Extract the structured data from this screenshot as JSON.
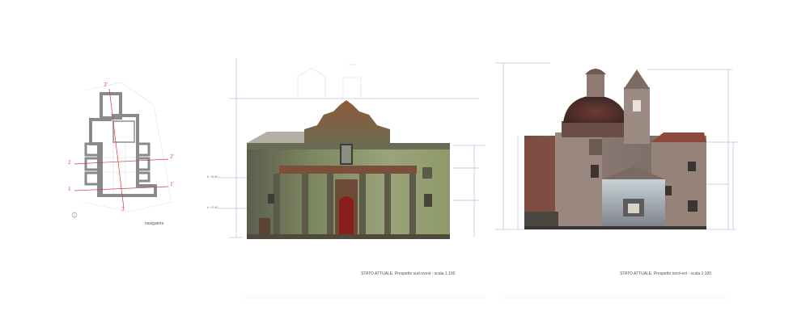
{
  "plan": {
    "caption": "navigatore",
    "section_marks": [
      "1'",
      "2'",
      "3'",
      "1",
      "2",
      "3"
    ]
  },
  "elevation_south": {
    "caption": "STATO ATTUALE, Prospetto sud-ovest - scala 1:100",
    "level_high": "h +8.50",
    "level_low": "h +3.90"
  },
  "elevation_north": {
    "caption": "STATO ATTUALE, Prospetto nord-est - scala 1:100"
  },
  "colors": {
    "plan_wall": "#8a8a8a",
    "section_line": "#d63b3b",
    "dimension_line": "#8a8ac8"
  }
}
